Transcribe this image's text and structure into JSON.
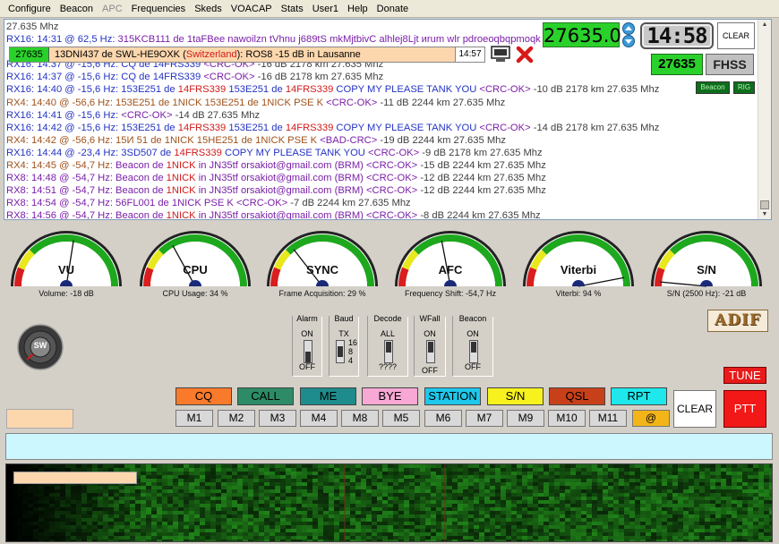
{
  "menu": [
    "Configure",
    "Beacon",
    "APC",
    "Frequencies",
    "Skeds",
    "VOACAP",
    "Stats",
    "User1",
    "Help",
    "Donate"
  ],
  "menu_disabled": [
    "APC"
  ],
  "log": {
    "lines": [
      [
        {
          "t": "27.635 Mhz",
          "c": "c-dgray"
        }
      ],
      [
        {
          "t": "RX16: 14:31 @ 62,5 Hz: ",
          "c": "c-blue"
        },
        {
          "t": "315KCB111 de 1taFBee nawoilzn  tVhnu j689tS mkMjtbivC alhlej8Ljt иrum wlr  pdroeoqbqpmoqk",
          "c": "c-purple"
        }
      ],
      [
        {
          "t": "",
          "c": ""
        }
      ],
      [
        {
          "t": "RX16: 14:37 @ -15,6 Hz: ",
          "c": "c-blue"
        },
        {
          "t": "CQ de 14FRS339 ",
          "c": "c-blue"
        },
        {
          "t": "<CRC-OK>",
          "c": "c-purple"
        },
        {
          "t": " -16 dB  2178 km   27.635 Mhz",
          "c": "c-dgray"
        }
      ],
      [
        {
          "t": "RX16: 14:37 @ -15,6 Hz: ",
          "c": "c-blue"
        },
        {
          "t": "CQ de 14FRS339 ",
          "c": "c-blue"
        },
        {
          "t": "<CRC-OK>",
          "c": "c-purple"
        },
        {
          "t": " -16 dB  2178 km   27.635 Mhz",
          "c": "c-dgray"
        }
      ],
      [
        {
          "t": "RX16: 14:40 @ -15,6 Hz: ",
          "c": "c-blue"
        },
        {
          "t": "153E251 de ",
          "c": "c-blue"
        },
        {
          "t": "14FRS339",
          "c": "c-red"
        },
        {
          "t": " 153E251 de ",
          "c": "c-blue"
        },
        {
          "t": "14FRS339",
          "c": "c-red"
        },
        {
          "t": " COPY MY PLEASE TANK YOU  ",
          "c": "c-blue"
        },
        {
          "t": "<CRC-OK>",
          "c": "c-purple"
        },
        {
          "t": " -10 dB  2178 km   27.635 Mhz",
          "c": "c-dgray"
        }
      ],
      [
        {
          "t": "RX4: 14:40 @ -56,6 Hz: ",
          "c": "c-brown"
        },
        {
          "t": "153E251 de 1NICK 153E251 de 1NICK PSE K  ",
          "c": "c-brown"
        },
        {
          "t": "<CRC-OK>",
          "c": "c-purple"
        },
        {
          "t": " -11 dB  2244 km   27.635 Mhz",
          "c": "c-dgray"
        }
      ],
      [
        {
          "t": "RX16: 14:41 @ -15,6 Hz:  ",
          "c": "c-blue"
        },
        {
          "t": "<CRC-OK>",
          "c": "c-purple"
        },
        {
          "t": " -14 dB  27.635 Mhz",
          "c": "c-dgray"
        }
      ],
      [
        {
          "t": "RX16: 14:42 @ -15,6 Hz: ",
          "c": "c-blue"
        },
        {
          "t": "153E251 de ",
          "c": "c-blue"
        },
        {
          "t": "14FRS339",
          "c": "c-red"
        },
        {
          "t": " 153E251 de ",
          "c": "c-blue"
        },
        {
          "t": "14FRS339",
          "c": "c-red"
        },
        {
          "t": " COPY MY PLEASE TANK YOU  ",
          "c": "c-blue"
        },
        {
          "t": "<CRC-OK>",
          "c": "c-purple"
        },
        {
          "t": " -14 dB  2178 km   27.635 Mhz",
          "c": "c-dgray"
        }
      ],
      [
        {
          "t": "RX4: 14:42 @ -56,6 Hz: ",
          "c": "c-brown"
        },
        {
          "t": "15И 51 de 1NICK 15НE251 de 1NICK PSE K  ",
          "c": "c-brown"
        },
        {
          "t": "<BAD-CRC>",
          "c": "c-purple"
        },
        {
          "t": " -19 dB  2244 km   27.635 Mhz",
          "c": "c-dgray"
        }
      ],
      [
        {
          "t": "RX16: 14:44 @ -23,4 Hz: ",
          "c": "c-blue"
        },
        {
          "t": "3SD507 de ",
          "c": "c-blue"
        },
        {
          "t": "14FRS339",
          "c": "c-red"
        },
        {
          "t": " COPY MY PLEASE TANK YOU  ",
          "c": "c-blue"
        },
        {
          "t": "<CRC-OK>",
          "c": "c-purple"
        },
        {
          "t": " -9 dB  2178 km   27.635 Mhz",
          "c": "c-dgray"
        }
      ],
      [
        {
          "t": "RX4: 14:45 @ -54,7 Hz: ",
          "c": "c-brown"
        },
        {
          "t": "Beacon de ",
          "c": "c-purple"
        },
        {
          "t": "1NICK",
          "c": "c-red"
        },
        {
          "t": " in JN35tf orsakiot@gmail.com (BRM) ",
          "c": "c-purple"
        },
        {
          "t": "<CRC-OK>",
          "c": "c-purple"
        },
        {
          "t": " -15 dB  2244 km   27.635 Mhz",
          "c": "c-dgray"
        }
      ],
      [
        {
          "t": "RX8: 14:48 @ -54,7 Hz: ",
          "c": "c-purple"
        },
        {
          "t": "Beacon de ",
          "c": "c-purple"
        },
        {
          "t": "1NICK",
          "c": "c-red"
        },
        {
          "t": " in JN35tf orsakiot@gmail.com (BRM) ",
          "c": "c-purple"
        },
        {
          "t": "<CRC-OK>",
          "c": "c-purple"
        },
        {
          "t": " -12 dB  2244 km   27.635 Mhz",
          "c": "c-dgray"
        }
      ],
      [
        {
          "t": "RX8: 14:51 @ -54,7 Hz: ",
          "c": "c-purple"
        },
        {
          "t": "Beacon de ",
          "c": "c-purple"
        },
        {
          "t": "1NICK",
          "c": "c-red"
        },
        {
          "t": " in JN35tf orsakiot@gmail.com (BRM) ",
          "c": "c-purple"
        },
        {
          "t": "<CRC-OK>",
          "c": "c-purple"
        },
        {
          "t": " -12 dB  2244 km   27.635 Mhz",
          "c": "c-dgray"
        }
      ],
      [
        {
          "t": "RX8: 14:54 @ -54,7 Hz: ",
          "c": "c-purple"
        },
        {
          "t": "56FL001 de 1NICK PSE K  ",
          "c": "c-purple"
        },
        {
          "t": "<CRC-OK>",
          "c": "c-purple"
        },
        {
          "t": " -7 dB  2244 km   27.635 Mhz",
          "c": "c-dgray"
        }
      ],
      [
        {
          "t": "RX8: 14:56 @ -54,7 Hz: ",
          "c": "c-purple"
        },
        {
          "t": "Beacon de ",
          "c": "c-purple"
        },
        {
          "t": "1NICK",
          "c": "c-red"
        },
        {
          "t": " in JN35tf orsakiot@gmail.com (BRM) ",
          "c": "c-purple"
        },
        {
          "t": "<CRC-OK>",
          "c": "c-purple"
        },
        {
          "t": " -8 dB  2244 km   27.635 Mhz",
          "c": "c-dgray"
        }
      ]
    ]
  },
  "overlay": {
    "freq": "27635",
    "text_a": "13DNI437 de SWL-HE9OXK (",
    "text_b": "Switzerland",
    "text_c": "): ROS8 -15 dB in Lausanne",
    "time": "14:57"
  },
  "controls": {
    "freq_display": "27635.0",
    "clock": "14:58",
    "clear_top": "CLEAR",
    "freq_small": "27635",
    "fhss": "FHSS",
    "beacon": "Beacon",
    "rig": "RIG"
  },
  "gauges": [
    {
      "name": "VU",
      "caption": "Volume: -18 dB",
      "needle": 0.55
    },
    {
      "name": "CPU",
      "caption": "CPU Usage: 34 %",
      "needle": 0.34
    },
    {
      "name": "SYNC",
      "caption": "Frame Acquisition: 29 %",
      "needle": 0.29
    },
    {
      "name": "AFC",
      "caption": "Frequency Shift: -54,7 Hz",
      "needle": 0.44
    },
    {
      "name": "Viterbi",
      "caption": "Viterbi: 94 %",
      "needle": 0.94
    },
    {
      "name": "S/N",
      "caption": "S/N (2500 Hz): -21 dB",
      "needle": 0.03
    }
  ],
  "sw_knob": "SW",
  "switches": {
    "alarm": {
      "title": "Alarm",
      "on": "ON",
      "off": "OFF"
    },
    "baud": {
      "title": "Baud",
      "tx": "TX",
      "opts": [
        "16",
        "8",
        "4"
      ]
    },
    "decode": {
      "title": "Decode",
      "top": "ALL",
      "bottom": "????"
    },
    "wfall": {
      "title": "WFall",
      "on": "ON",
      "off": "OFF"
    },
    "beacon": {
      "title": "Beacon",
      "on": "ON",
      "off": "OFF"
    }
  },
  "adif": "ADIF",
  "macros": [
    {
      "label": "CQ",
      "color": "#f97a2a"
    },
    {
      "label": "CALL",
      "color": "#2d8c67"
    },
    {
      "label": "ME",
      "color": "#1e8c8c"
    },
    {
      "label": "BYE",
      "color": "#f7a8d4"
    },
    {
      "label": "STATION",
      "color": "#1ec8ec"
    },
    {
      "label": "S/N",
      "color": "#f7f21e"
    },
    {
      "label": "QSL",
      "color": "#c8401a"
    },
    {
      "label": "RPT",
      "color": "#1ee8ec"
    }
  ],
  "mem_buttons": [
    "M1",
    "M2",
    "M3",
    "M4",
    "M8",
    "M5",
    "M6",
    "M7",
    "M9",
    "M10",
    "M11",
    "@"
  ],
  "clear_btn": "CLEAR",
  "tune_btn": "TUNE",
  "ptt_btn": "PTT",
  "colors": {
    "accent_green": "#2bd12b",
    "ptt_red": "#f21818",
    "input_cyan": "#ccf7ff",
    "peach": "#fcd7ae"
  }
}
